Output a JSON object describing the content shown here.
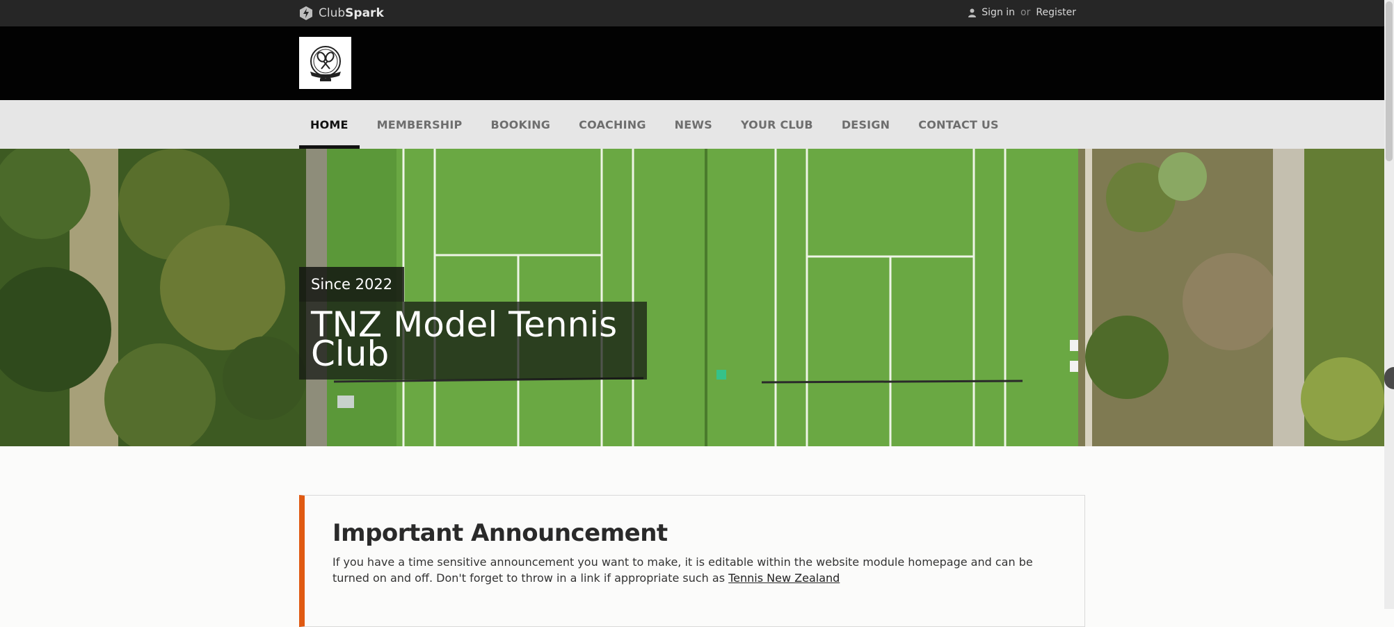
{
  "topbar": {
    "brand_prefix": "Club",
    "brand_suffix": "Spark",
    "sign_in": "Sign in",
    "or": "or",
    "register": "Register"
  },
  "nav": {
    "items": [
      "HOME",
      "MEMBERSHIP",
      "BOOKING",
      "COACHING",
      "NEWS",
      "YOUR CLUB",
      "DESIGN",
      "CONTACT US"
    ],
    "active": "HOME"
  },
  "hero": {
    "since": "Since 2022",
    "club_name": "TNZ Model Tennis Club"
  },
  "announcement": {
    "title": "Important Announcement",
    "body": "If you have a time sensitive announcement you want to make, it is editable within the website module homepage and can be turned on and off. Don't forget to throw in a link if appropriate such as ",
    "link_text": "Tennis New Zealand"
  },
  "colors": {
    "topbar": "#262626",
    "logo_band": "#020202",
    "nav_bg": "#e6e6e6",
    "accent": "#e05a12",
    "court_green": "#6aa843"
  },
  "icons": [
    "clubspark-logo-icon",
    "user-icon",
    "club-crest-logo"
  ]
}
